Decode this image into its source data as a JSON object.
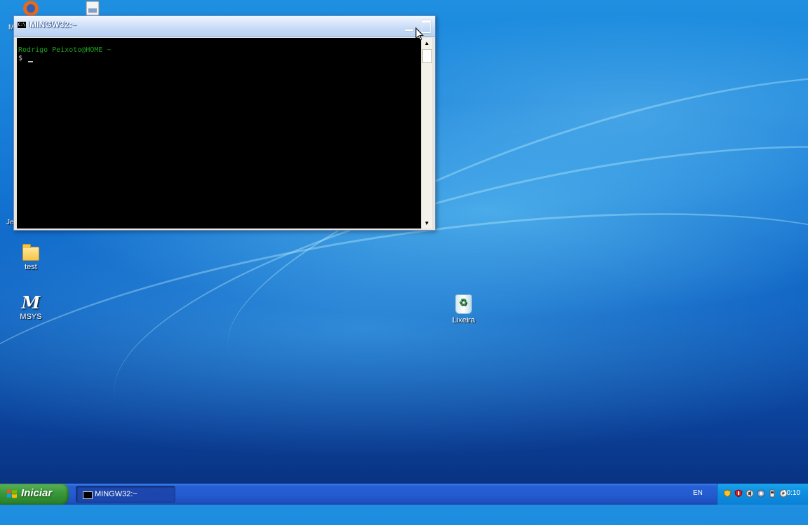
{
  "desktop": {
    "icons": [
      {
        "name": "test",
        "label": "test"
      },
      {
        "name": "MSYS",
        "label": "MSYS"
      },
      {
        "name": "Lixeira",
        "label": "Lixeira"
      }
    ],
    "partial_labels": {
      "top_left": "M",
      "side_left": "Je"
    }
  },
  "console": {
    "title": "MINGW32:~",
    "icon_text": "C:\\",
    "prompt": "Rodrigo Peixoto@HOME ~",
    "dollar": "$"
  },
  "taskbar": {
    "start_label": "Iniciar",
    "task_label": "MINGW32:~",
    "language": "EN",
    "clock": "10:10"
  },
  "colors": {
    "prompt_green": "#1ea01e",
    "start_green": "#3c9a3c",
    "taskbar_blue": "#245cd0",
    "tray_blue": "#0f8fe0"
  }
}
